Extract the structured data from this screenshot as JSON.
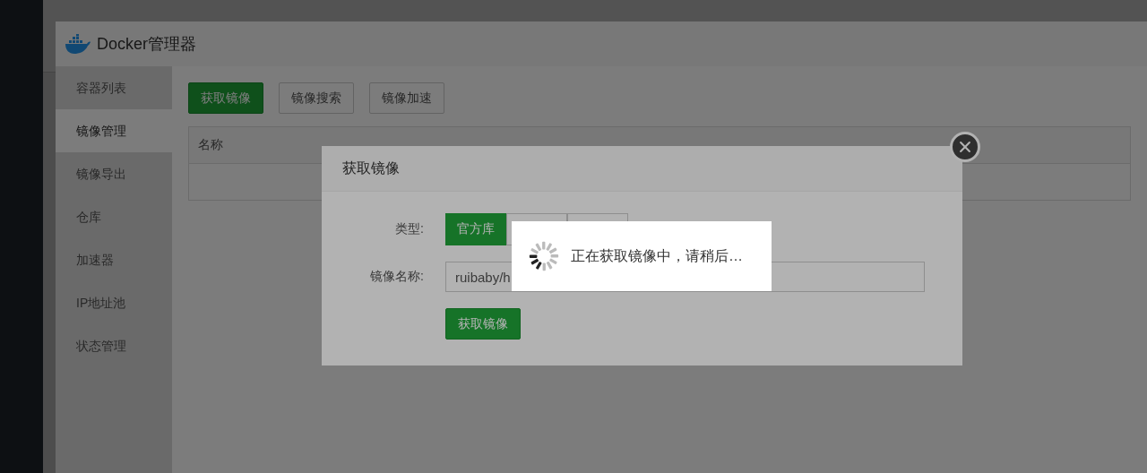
{
  "window": {
    "title": "Docker管理器"
  },
  "sidebar": {
    "items": [
      {
        "label": "容器列表",
        "selected": false
      },
      {
        "label": "镜像管理",
        "selected": true
      },
      {
        "label": "镜像导出",
        "selected": false
      },
      {
        "label": "仓库",
        "selected": false
      },
      {
        "label": "加速器",
        "selected": false
      },
      {
        "label": "IP地址池",
        "selected": false
      },
      {
        "label": "状态管理",
        "selected": false
      }
    ]
  },
  "toolbar": {
    "buttons": [
      {
        "label": "获取镜像",
        "kind": "primary"
      },
      {
        "label": "镜像搜索",
        "kind": "default"
      },
      {
        "label": "镜像加速",
        "kind": "default"
      }
    ]
  },
  "table": {
    "columns": [
      "名称"
    ]
  },
  "dialog": {
    "title": "获取镜像",
    "type_label": "类型:",
    "type_options": [
      {
        "label": "官方库",
        "selected": true
      },
      {
        "selected": false
      },
      {
        "selected": false
      }
    ],
    "name_label": "镜像名称:",
    "name_value": "ruibaby/h",
    "submit": "获取镜像"
  },
  "loading": {
    "message": "正在获取镜像中，请稍后…"
  }
}
